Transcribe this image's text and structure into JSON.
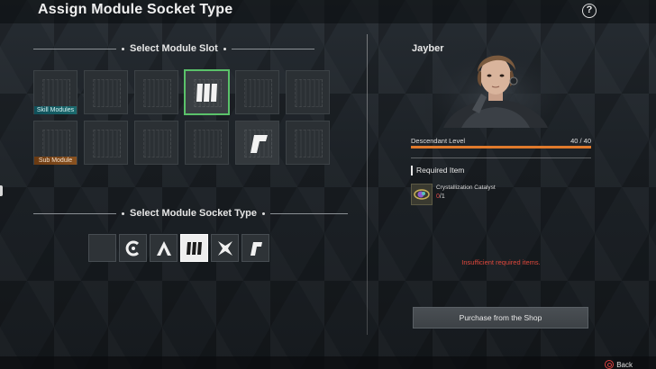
{
  "header": {
    "title": "Assign Module Socket Type",
    "help_label": "?"
  },
  "slot_section": {
    "title": "Select Module Slot"
  },
  "slots": {
    "row1_label": "Skill Modules",
    "row2_label": "Sub Module",
    "selected_slot_glyph": "malachite-socket-icon",
    "slot_with_glyph_row2": "rutile-socket-icon"
  },
  "socket_section": {
    "title": "Select Module Socket Type",
    "types": [
      {
        "name": "empty-socket",
        "icon": "blank"
      },
      {
        "name": "cerulean-socket",
        "icon": "cerulean-icon"
      },
      {
        "name": "almandine-socket",
        "icon": "almandine-icon"
      },
      {
        "name": "malachite-socket",
        "icon": "malachite-icon",
        "selected": true
      },
      {
        "name": "xantic-socket",
        "icon": "xantic-icon"
      },
      {
        "name": "rutile-socket",
        "icon": "rutile-icon"
      }
    ]
  },
  "character": {
    "name": "Jayber",
    "level_label": "Descendant Level",
    "level_value": "40 / 40",
    "level_fraction": 1.0
  },
  "required": {
    "title": "Required Item",
    "item_name": "Crystallization Catalyst",
    "have": "0",
    "need": "/1"
  },
  "status": {
    "message": "Insufficient required items."
  },
  "actions": {
    "purchase_label": "Purchase from the Shop",
    "back_label": "Back"
  },
  "colors": {
    "accent_green": "#5ac26a",
    "level_orange": "#e07a2c",
    "warning_red": "#e0483c",
    "skill_teal": "#1b6a6e",
    "sub_orange": "#8a5220"
  }
}
